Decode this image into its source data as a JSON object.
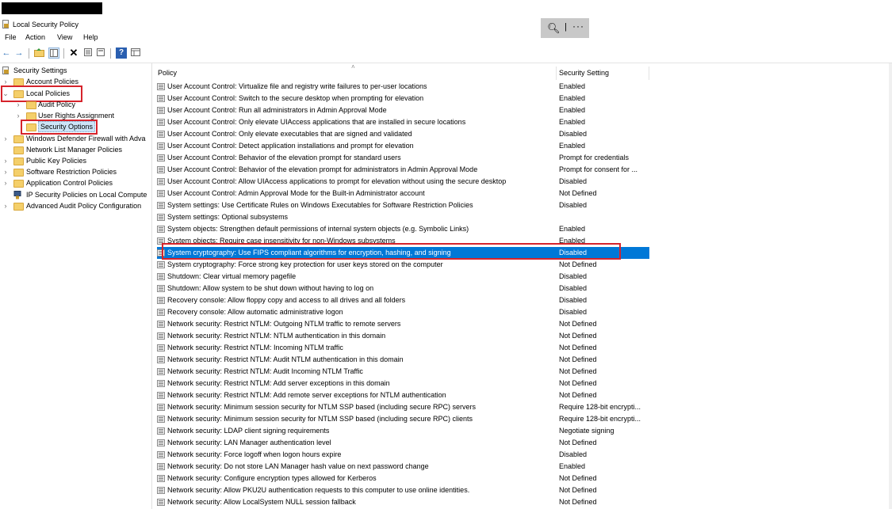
{
  "window": {
    "title": "Local Security Policy"
  },
  "menu": [
    "File",
    "Action",
    "View",
    "Help"
  ],
  "zoom_control": {
    "zoom_icon": "zoom-in-icon",
    "separator": "|",
    "more": "···"
  },
  "tree": {
    "root": "Security Settings",
    "items": [
      {
        "label": "Account Policies",
        "level": 1,
        "icon": "folder-icon"
      },
      {
        "label": "Local Policies",
        "level": 1,
        "icon": "folder-icon"
      },
      {
        "label": "Audit Policy",
        "level": 2,
        "icon": "folder-icon"
      },
      {
        "label": "User Rights Assignment",
        "level": 2,
        "icon": "folder-icon"
      },
      {
        "label": "Security Options",
        "level": 2,
        "icon": "folder-icon"
      },
      {
        "label": "Windows Defender Firewall with Adva",
        "level": 1,
        "icon": "folder-icon"
      },
      {
        "label": "Network List Manager Policies",
        "level": 1,
        "icon": "folder-icon"
      },
      {
        "label": "Public Key Policies",
        "level": 1,
        "icon": "folder-icon"
      },
      {
        "label": "Software Restriction Policies",
        "level": 1,
        "icon": "folder-icon"
      },
      {
        "label": "Application Control Policies",
        "level": 1,
        "icon": "folder-icon"
      },
      {
        "label": "IP Security Policies on Local Compute",
        "level": 1,
        "icon": "security-icon"
      },
      {
        "label": "Advanced Audit Policy Configuration",
        "level": 1,
        "icon": "folder-icon"
      }
    ]
  },
  "list": {
    "columns": {
      "policy": "Policy",
      "setting": "Security Setting"
    },
    "selected_index": 14,
    "rows": [
      {
        "policy": "User Account Control: Virtualize file and registry write failures to per-user locations",
        "setting": "Enabled"
      },
      {
        "policy": "User Account Control: Switch to the secure desktop when prompting for elevation",
        "setting": "Enabled"
      },
      {
        "policy": "User Account Control: Run all administrators in Admin Approval Mode",
        "setting": "Enabled"
      },
      {
        "policy": "User Account Control: Only elevate UIAccess applications that are installed in secure locations",
        "setting": "Enabled"
      },
      {
        "policy": "User Account Control: Only elevate executables that are signed and validated",
        "setting": "Disabled"
      },
      {
        "policy": "User Account Control: Detect application installations and prompt for elevation",
        "setting": "Enabled"
      },
      {
        "policy": "User Account Control: Behavior of the elevation prompt for standard users",
        "setting": "Prompt for credentials"
      },
      {
        "policy": "User Account Control: Behavior of the elevation prompt for administrators in Admin Approval Mode",
        "setting": "Prompt for consent for ..."
      },
      {
        "policy": "User Account Control: Allow UIAccess applications to prompt for elevation without using the secure desktop",
        "setting": "Disabled"
      },
      {
        "policy": "User Account Control: Admin Approval Mode for the Built-in Administrator account",
        "setting": "Not Defined"
      },
      {
        "policy": "System settings: Use Certificate Rules on Windows Executables for Software Restriction Policies",
        "setting": "Disabled"
      },
      {
        "policy": "System settings: Optional subsystems",
        "setting": ""
      },
      {
        "policy": "System objects: Strengthen default permissions of internal system objects (e.g. Symbolic Links)",
        "setting": "Enabled"
      },
      {
        "policy": "System objects: Require case insensitivity for non-Windows subsystems",
        "setting": "Enabled"
      },
      {
        "policy": "System cryptography: Use FIPS compliant algorithms for encryption, hashing, and signing",
        "setting": "Disabled"
      },
      {
        "policy": "System cryptography: Force strong key protection for user keys stored on the computer",
        "setting": "Not Defined"
      },
      {
        "policy": "Shutdown: Clear virtual memory pagefile",
        "setting": "Disabled"
      },
      {
        "policy": "Shutdown: Allow system to be shut down without having to log on",
        "setting": "Disabled"
      },
      {
        "policy": "Recovery console: Allow floppy copy and access to all drives and all folders",
        "setting": "Disabled"
      },
      {
        "policy": "Recovery console: Allow automatic administrative logon",
        "setting": "Disabled"
      },
      {
        "policy": "Network security: Restrict NTLM: Outgoing NTLM traffic to remote servers",
        "setting": "Not Defined"
      },
      {
        "policy": "Network security: Restrict NTLM: NTLM authentication in this domain",
        "setting": "Not Defined"
      },
      {
        "policy": "Network security: Restrict NTLM: Incoming NTLM traffic",
        "setting": "Not Defined"
      },
      {
        "policy": "Network security: Restrict NTLM: Audit NTLM authentication in this domain",
        "setting": "Not Defined"
      },
      {
        "policy": "Network security: Restrict NTLM: Audit Incoming NTLM Traffic",
        "setting": "Not Defined"
      },
      {
        "policy": "Network security: Restrict NTLM: Add server exceptions in this domain",
        "setting": "Not Defined"
      },
      {
        "policy": "Network security: Restrict NTLM: Add remote server exceptions for NTLM authentication",
        "setting": "Not Defined"
      },
      {
        "policy": "Network security: Minimum session security for NTLM SSP based (including secure RPC) servers",
        "setting": "Require 128-bit encrypti..."
      },
      {
        "policy": "Network security: Minimum session security for NTLM SSP based (including secure RPC) clients",
        "setting": "Require 128-bit encrypti..."
      },
      {
        "policy": "Network security: LDAP client signing requirements",
        "setting": "Negotiate signing"
      },
      {
        "policy": "Network security: LAN Manager authentication level",
        "setting": "Not Defined"
      },
      {
        "policy": "Network security: Force logoff when logon hours expire",
        "setting": "Disabled"
      },
      {
        "policy": "Network security: Do not store LAN Manager hash value on next password change",
        "setting": "Enabled"
      },
      {
        "policy": "Network security: Configure encryption types allowed for Kerberos",
        "setting": "Not Defined"
      },
      {
        "policy": "Network security: Allow PKU2U authentication requests to this computer to use online identities.",
        "setting": "Not Defined"
      },
      {
        "policy": "Network security: Allow LocalSystem NULL session fallback",
        "setting": "Not Defined"
      }
    ]
  },
  "colors": {
    "selection": "#0078d7",
    "highlight_box": "#d6232b",
    "folder": "#f4cf6a"
  }
}
